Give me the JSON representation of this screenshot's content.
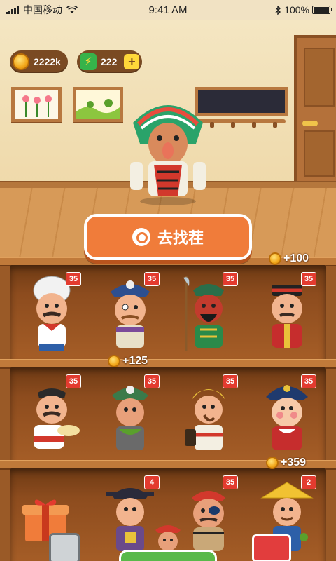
{
  "status_bar": {
    "carrier": "中国移动",
    "time": "9:41 AM",
    "battery": "100%",
    "battery_level": 1.0
  },
  "currency": {
    "coins": "2222k",
    "energy": "222"
  },
  "search_button": {
    "label": "去找茬"
  },
  "shelves": [
    {
      "reward": "+100",
      "slots": [
        {
          "character": "chef",
          "level": "35"
        },
        {
          "character": "pirate",
          "level": "35"
        },
        {
          "character": "general",
          "level": "35"
        },
        {
          "character": "bandit",
          "level": "35"
        }
      ]
    },
    {
      "reward": "+125",
      "slots": [
        {
          "character": "cook",
          "level": "35"
        },
        {
          "character": "skull-pirate",
          "level": "35"
        },
        {
          "character": "scarf-woman",
          "level": "35"
        },
        {
          "character": "captain",
          "level": "35"
        }
      ]
    },
    {
      "reward": "+359",
      "slots": [
        {
          "character": "gift-box",
          "level": ""
        },
        {
          "character": "official",
          "level": "4"
        },
        {
          "character": "eyepatch-pirate",
          "level": "35"
        },
        {
          "character": "straw-hat",
          "level": "2"
        }
      ]
    }
  ],
  "colors": {
    "accent": "#f07c3a",
    "badge": "#e33b2f",
    "wood": "#9a5a27"
  }
}
